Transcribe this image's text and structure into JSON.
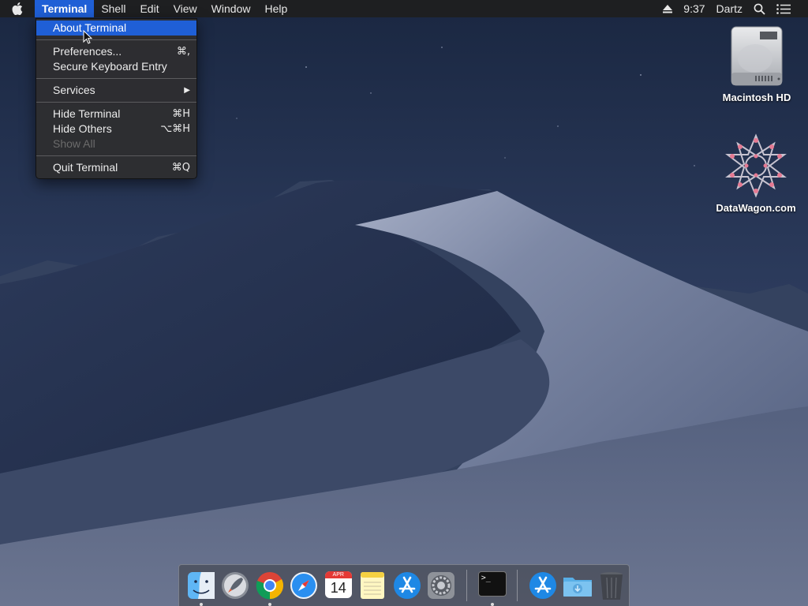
{
  "menubar": {
    "apple_icon": "apple-icon",
    "items": [
      {
        "label": "Terminal"
      },
      {
        "label": "Shell"
      },
      {
        "label": "Edit"
      },
      {
        "label": "View"
      },
      {
        "label": "Window"
      },
      {
        "label": "Help"
      }
    ],
    "status": {
      "eject_icon": "eject-icon",
      "time": "9:37",
      "user": "Dartz",
      "search_icon": "spotlight-icon",
      "notification_icon": "notification-center-icon"
    }
  },
  "dropdown": {
    "items": [
      {
        "label": "About Terminal",
        "shortcut": ""
      },
      {
        "label": "Preferences...",
        "shortcut": "⌘,"
      },
      {
        "label": "Secure Keyboard Entry",
        "shortcut": ""
      },
      {
        "label": "Services",
        "shortcut": "▶"
      },
      {
        "label": "Hide Terminal",
        "shortcut": "⌘H"
      },
      {
        "label": "Hide Others",
        "shortcut": "⌥⌘H"
      },
      {
        "label": "Show All",
        "shortcut": ""
      },
      {
        "label": "Quit Terminal",
        "shortcut": "⌘Q"
      }
    ]
  },
  "desktop": {
    "icons": [
      {
        "label": "Macintosh HD",
        "icon": "hard-drive-icon"
      },
      {
        "label": "DataWagon.com",
        "icon": "datawagon-logo-icon"
      }
    ]
  },
  "dock": {
    "apps": [
      {
        "name": "Finder",
        "icon": "finder-icon",
        "running": true
      },
      {
        "name": "Launchpad",
        "icon": "launchpad-icon",
        "running": false
      },
      {
        "name": "Google Chrome",
        "icon": "chrome-icon",
        "running": true
      },
      {
        "name": "Safari",
        "icon": "safari-icon",
        "running": false
      },
      {
        "name": "Calendar",
        "icon": "calendar-icon",
        "running": false,
        "month": "APR",
        "day": "14"
      },
      {
        "name": "Notes",
        "icon": "notes-icon",
        "running": false
      },
      {
        "name": "App Store",
        "icon": "app-store-icon",
        "running": false
      },
      {
        "name": "System Preferences",
        "icon": "system-preferences-icon",
        "running": false
      },
      {
        "name": "Terminal",
        "icon": "terminal-icon",
        "running": true,
        "prompt": ">_"
      },
      {
        "name": "Applications",
        "icon": "applications-folder-icon",
        "running": false
      },
      {
        "name": "Downloads",
        "icon": "downloads-folder-icon",
        "running": false
      },
      {
        "name": "Trash",
        "icon": "trash-icon",
        "running": false
      }
    ]
  },
  "colors": {
    "highlight": "#1f5fd6",
    "menubar_bg": "#1e1e1e",
    "dropdown_bg": "#2e2e30"
  }
}
